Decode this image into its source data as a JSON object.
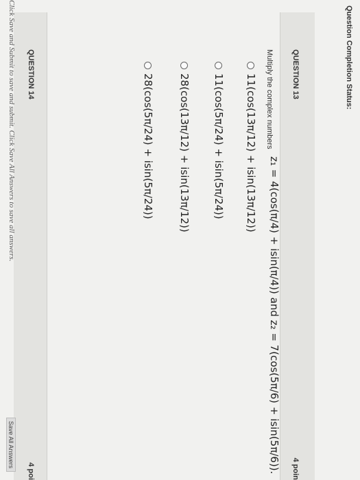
{
  "status": {
    "label": "Question Completion Status:"
  },
  "q13": {
    "title": "QUESTION 13",
    "points": "4 poin",
    "prompt": "Multiply the complex numbers",
    "math": "z₁ = 4(cos(π/4) + isin(π/4)) and z₂ = 7(cos(5π/6) + isin(5π/6)).",
    "options": [
      "11(cos(13π/12) + isin(13π/12))",
      "11(cos(5π/24) + isin(5π/24))",
      "28(cos(13π/12) + isin(13π/12))",
      "28(cos(5π/24) + isin(5π/24))"
    ]
  },
  "q14": {
    "title": "QUESTION 14",
    "points": "4 poi"
  },
  "footer": {
    "note": "Click Save and Submit to save and submit. Click Save All Answers to save all answers.",
    "save_all": "Save All Answers"
  }
}
